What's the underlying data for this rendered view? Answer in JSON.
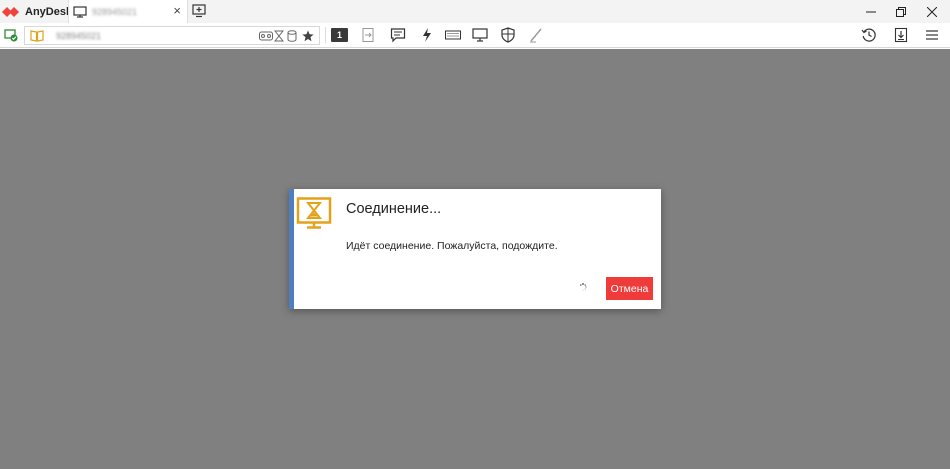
{
  "app": {
    "name": "AnyDesk",
    "logo_color": "#ef443b"
  },
  "tab": {
    "label": "928945021",
    "close_glyph": "×"
  },
  "toolbar": {
    "address_value": "928945021",
    "monitor_number": "1"
  },
  "icons": {
    "status": "connection-status-icon",
    "address_book": "address-book-icon",
    "star": "favorite-star-icon",
    "chat": "chat-icon",
    "actions": "lightning-icon",
    "keyboard": "keyboard-icon",
    "display": "display-icon",
    "permissions": "shield-icon",
    "whiteboard": "pen-icon",
    "history": "history-icon",
    "downloads": "download-icon",
    "menu": "hamburger-menu-icon"
  },
  "dialog": {
    "title": "Соединение...",
    "message": "Идёт соединение. Пожалуйста, подождите.",
    "cancel_label": "Отмена",
    "accent_color": "#4f7ec0",
    "icon_color": "#e3a21a",
    "button_color": "#ef3b39"
  },
  "colors": {
    "background": "#808080",
    "titlebar": "#f3f3f3"
  }
}
